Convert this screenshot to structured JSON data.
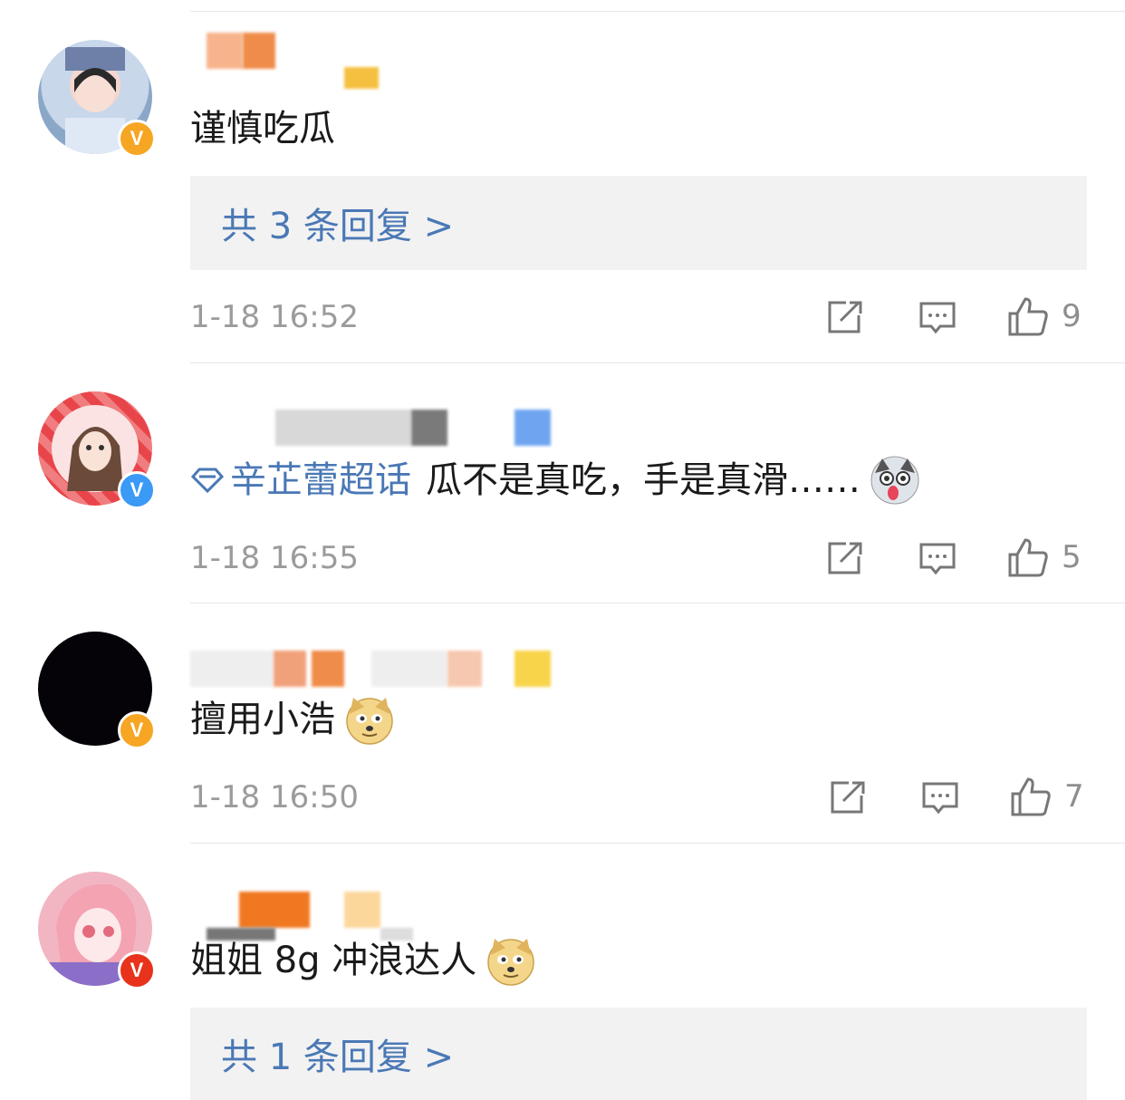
{
  "comments": [
    {
      "text": "谨慎吃瓜",
      "reply_summary": "共 3 条回复 >",
      "time": "1-18 16:52",
      "likes": "9",
      "badge": "gold"
    },
    {
      "topic": "辛芷蕾超话",
      "text": "瓜不是真吃，手是真滑……",
      "time": "1-18 16:55",
      "likes": "5",
      "badge": "blue"
    },
    {
      "text": "擅用小浩",
      "time": "1-18 16:50",
      "likes": "7",
      "badge": "gold"
    },
    {
      "text": "姐姐 8g 冲浪达人",
      "reply_summary": "共 1 条回复 >",
      "badge": "red"
    }
  ],
  "icons": {
    "repost": "repost-icon",
    "comment": "comment-icon",
    "like": "thumbs-up-icon",
    "topic": "diamond-topic-icon",
    "emoji_husky": "husky-emoji-icon",
    "emoji_doge": "doge-emoji-icon"
  },
  "colors": {
    "link_blue": "#4a78b5",
    "verified_gold": "#f6a623",
    "verified_blue": "#3a9af5",
    "verified_red": "#e8321b",
    "timestamp_gray": "#9b9b9b",
    "reply_box_bg": "#f2f2f2"
  }
}
